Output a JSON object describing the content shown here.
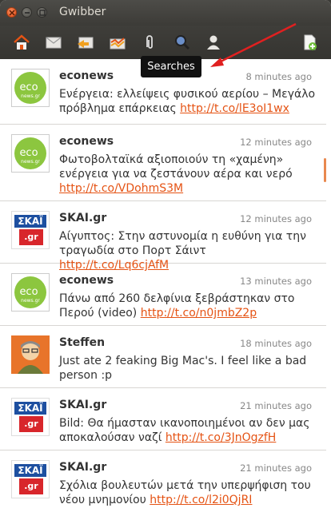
{
  "window": {
    "title": "Gwibber"
  },
  "tooltip": "Searches",
  "brand": {
    "accent": "#e55314",
    "titlebar": "#3c3b37"
  },
  "toolbar": {
    "icons": [
      "home-icon",
      "mail-icon",
      "replies-icon",
      "private-messages-icon",
      "attachment-icon",
      "search-icon",
      "user-icon",
      "new-stream-icon"
    ]
  },
  "messages": [
    {
      "sender": "econews",
      "time": "8 minutes ago",
      "text": "Ενέργεια: ελλείψεις φυσικού αερίου – Μεγάλο πρόβλημα επάρκειας ",
      "link": "http://t.co/lE3oI1wx",
      "avatar": "eco"
    },
    {
      "sender": "econews",
      "time": "12 minutes ago",
      "text": "Φωτοβολταϊκά αξιοποιούν τη «χαμένη» ενέργεια για να ζεστάνουν αέρα και νερό ",
      "link": "http://t.co/VDohmS3M",
      "avatar": "eco"
    },
    {
      "sender": "SKAI.gr",
      "time": "12 minutes ago",
      "text": "Αίγυπτος: Στην αστυνομία η ευθύνη για την τραγωδία στο Πορτ Σάιντ ",
      "link": "http://t.co/Lq6cjAfM",
      "avatar": "skai"
    },
    {
      "sender": "econews",
      "time": "13 minutes ago",
      "text": "Πάνω από 260 δελφίνια ξεβράστηκαν στο Περού (video) ",
      "link": "http://t.co/n0jmbZ2p",
      "avatar": "eco"
    },
    {
      "sender": "Steffen",
      "time": "18 minutes ago",
      "text": "Just ate 2 feaking Big Mac's. I feel like a bad person :p",
      "link": "",
      "avatar": "steffen"
    },
    {
      "sender": "SKAI.gr",
      "time": "21 minutes ago",
      "text": "Bild: Θα ήμασταν ικανοποιημένοι αν δεν μας αποκαλούσαν ναζί ",
      "link": "http://t.co/3JnOgzfH",
      "avatar": "skai"
    },
    {
      "sender": "SKAI.gr",
      "time": "21 minutes ago",
      "text": "Σχόλια βουλευτών μετά την υπερψήφιση του νέου μνημονίου ",
      "link": "http://t.co/l2i0QjRI",
      "avatar": "skai"
    }
  ],
  "avatars": {
    "eco_label": "eco",
    "eco_sub": "news.gr",
    "skai_top": "ΣΚΑΪ",
    "skai_bot": ".gr"
  }
}
